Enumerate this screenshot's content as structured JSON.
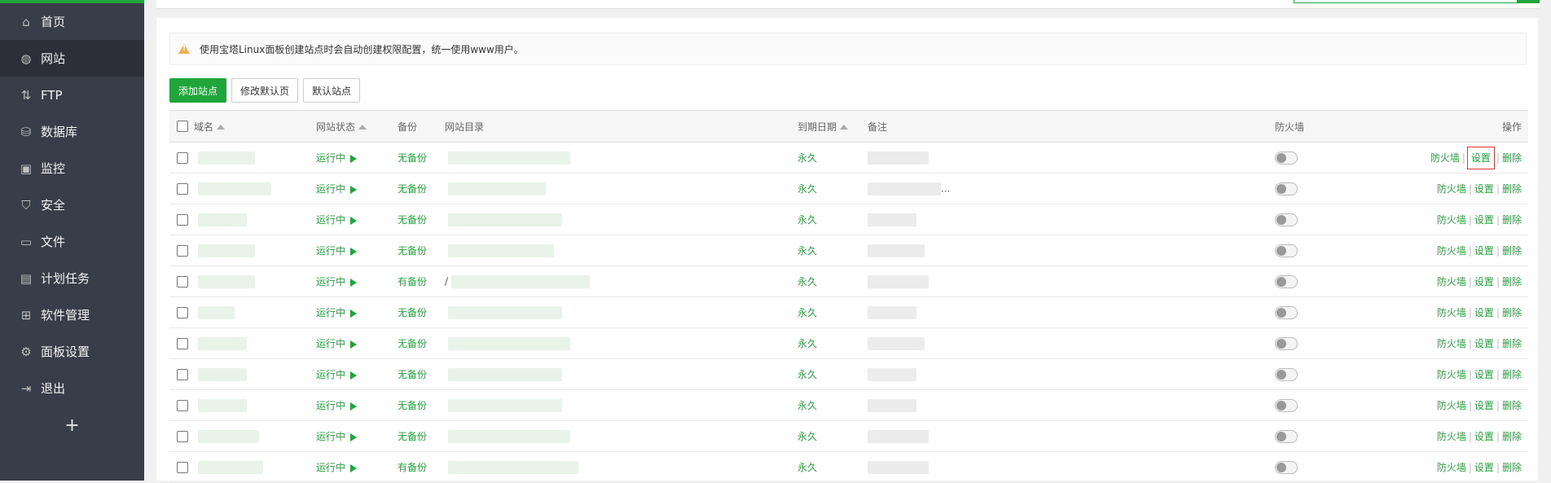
{
  "sidebar": {
    "items": [
      {
        "icon": "home-icon",
        "glyph": "⌂",
        "label": "首页",
        "active": false
      },
      {
        "icon": "globe-icon",
        "glyph": "◍",
        "label": "网站",
        "active": true
      },
      {
        "icon": "ftp-icon",
        "glyph": "⇅",
        "label": "FTP",
        "active": false
      },
      {
        "icon": "database-icon",
        "glyph": "⛁",
        "label": "数据库",
        "active": false
      },
      {
        "icon": "monitor-icon",
        "glyph": "▣",
        "label": "监控",
        "active": false
      },
      {
        "icon": "shield-icon",
        "glyph": "⛉",
        "label": "安全",
        "active": false
      },
      {
        "icon": "folder-icon",
        "glyph": "▭",
        "label": "文件",
        "active": false
      },
      {
        "icon": "calendar-icon",
        "glyph": "▤",
        "label": "计划任务",
        "active": false
      },
      {
        "icon": "apps-icon",
        "glyph": "⊞",
        "label": "软件管理",
        "active": false
      },
      {
        "icon": "gear-icon",
        "glyph": "⚙",
        "label": "面板设置",
        "active": false
      },
      {
        "icon": "logout-icon",
        "glyph": "⇥",
        "label": "退出",
        "active": false
      }
    ],
    "add_label": "+"
  },
  "alert": {
    "text": "使用宝塔Linux面板创建站点时会自动创建权限配置，统一使用www用户。"
  },
  "toolbar": {
    "add_site": "添加站点",
    "edit_default_page": "修改默认页",
    "default_site": "默认站点"
  },
  "table": {
    "headers": {
      "domain": "域名",
      "status": "网站状态",
      "backup": "备份",
      "root": "网站目录",
      "expire": "到期日期",
      "note": "备注",
      "firewall": "防火墙",
      "ops": "操作"
    },
    "rows": [
      {
        "status": "运行中",
        "backup": "无备份",
        "expire": "永久",
        "root_suffix": "",
        "note_suffix": ""
      },
      {
        "status": "运行中",
        "backup": "无备份",
        "expire": "永久",
        "root_suffix": "",
        "note_suffix": "..."
      },
      {
        "status": "运行中",
        "backup": "无备份",
        "expire": "永久",
        "root_suffix": "",
        "note_suffix": ""
      },
      {
        "status": "运行中",
        "backup": "无备份",
        "expire": "永久",
        "root_suffix": "",
        "note_suffix": ""
      },
      {
        "status": "运行中",
        "backup": "有备份",
        "expire": "永久",
        "root_suffix": "/",
        "note_suffix": ""
      },
      {
        "status": "运行中",
        "backup": "无备份",
        "expire": "永久",
        "root_suffix": "",
        "note_suffix": ""
      },
      {
        "status": "运行中",
        "backup": "无备份",
        "expire": "永久",
        "root_suffix": "",
        "note_suffix": ""
      },
      {
        "status": "运行中",
        "backup": "无备份",
        "expire": "永久",
        "root_suffix": "",
        "note_suffix": ""
      },
      {
        "status": "运行中",
        "backup": "无备份",
        "expire": "永久",
        "root_suffix": "",
        "note_suffix": ""
      },
      {
        "status": "运行中",
        "backup": "无备份",
        "expire": "永久",
        "root_suffix": "",
        "note_suffix": ""
      },
      {
        "status": "运行中",
        "backup": "有备份",
        "expire": "永久",
        "root_suffix": "",
        "note_suffix": ""
      }
    ],
    "ops": {
      "firewall": "防火墙",
      "settings": "设置",
      "delete": "删除"
    },
    "highlighted_settings_row": 0
  },
  "colors": {
    "accent": "#20a53a",
    "sidebar": "#393d49",
    "highlight": "#e33333"
  }
}
